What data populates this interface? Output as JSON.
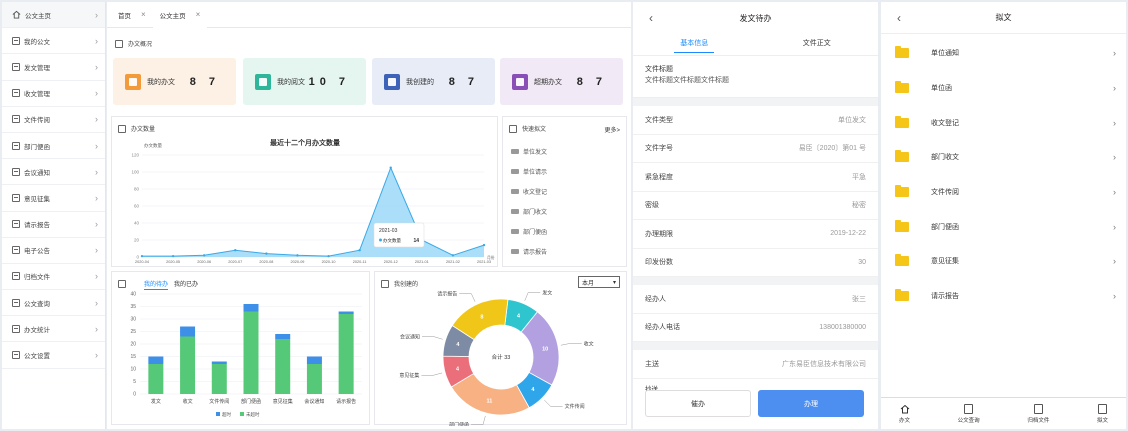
{
  "sidebar": {
    "items": [
      {
        "label": "公文主页",
        "icon": "home-icon"
      },
      {
        "label": "我的公文",
        "icon": "document-icon"
      },
      {
        "label": "发文管理",
        "icon": "document-icon"
      },
      {
        "label": "收文管理",
        "icon": "document-icon"
      },
      {
        "label": "文件传阅",
        "icon": "document-icon"
      },
      {
        "label": "部门便函",
        "icon": "document-icon"
      },
      {
        "label": "会议通知",
        "icon": "document-icon"
      },
      {
        "label": "意见征集",
        "icon": "document-icon"
      },
      {
        "label": "请示报告",
        "icon": "document-icon"
      },
      {
        "label": "电子公告",
        "icon": "document-icon"
      },
      {
        "label": "归档文件",
        "icon": "document-icon"
      },
      {
        "label": "公文查询",
        "icon": "document-icon"
      },
      {
        "label": "办文统计",
        "icon": "document-icon"
      },
      {
        "label": "公文设置",
        "icon": "document-icon"
      }
    ]
  },
  "tabs": [
    {
      "label": "首页"
    },
    {
      "label": "公文主页"
    }
  ],
  "overview": {
    "title": "办文概况",
    "cards": [
      {
        "label": "我的办文",
        "value": "8 7",
        "color": "#f39b3a",
        "bg": "#fdf1e6"
      },
      {
        "label": "我的阅文",
        "value": "10 7",
        "color": "#2fb59a",
        "bg": "#e5f6f1"
      },
      {
        "label": "我创建的",
        "value": "8 7",
        "color": "#3e62b8",
        "bg": "#e7ecf7"
      },
      {
        "label": "超期办文",
        "value": "8 7",
        "color": "#8a4fb6",
        "bg": "#f1e9f6"
      }
    ]
  },
  "count_panel": {
    "title": "办文数量",
    "chart_title": "最近十二个月办文数量",
    "ylabel": "办文数量",
    "x_unit": "月份",
    "tooltip_month": "2021-03",
    "tooltip_series": "办文数量",
    "tooltip_value": "14"
  },
  "quick_panel": {
    "title": "快速拟文",
    "more": "更多>",
    "items": [
      "单位发文",
      "单位请示",
      "收文登记",
      "部门收文",
      "部门便函",
      "请示报告"
    ]
  },
  "pending_panel": {
    "tab_active": "我的待办",
    "tab_other": "我的已办",
    "legend": [
      "超时",
      "未超时"
    ]
  },
  "created_panel": {
    "title": "我创建的",
    "select_value": "本月",
    "center_label": "合计 33"
  },
  "doc_pending": {
    "title": "发文待办",
    "tab_active": "基本信息",
    "tab_other": "文件正文",
    "heading_label": "文件标题",
    "heading_value": "文件标题文件标题文件标题",
    "rows1": [
      {
        "label": "文件类型",
        "value": "单位发文"
      },
      {
        "label": "文件字号",
        "value": "易臣〔2020〕第01 号"
      },
      {
        "label": "紧急程度",
        "value": "平急"
      },
      {
        "label": "密级",
        "value": "秘密"
      },
      {
        "label": "办理期限",
        "value": "2019-12-22"
      },
      {
        "label": "印发份数",
        "value": "30"
      }
    ],
    "rows2": [
      {
        "label": "经办人",
        "value": "张三"
      },
      {
        "label": "经办人电话",
        "value": "138001380000"
      }
    ],
    "rows3": [
      {
        "label": "主送",
        "value": "广东易臣信息技术有限公司"
      }
    ],
    "chaosong": "抄送",
    "btn_urge": "催办",
    "btn_handle": "办理"
  },
  "draft": {
    "title": "拟文",
    "items": [
      "单位通知",
      "单位函",
      "收文登记",
      "部门收文",
      "文件传阅",
      "部门便函",
      "意见征集",
      "请示报告"
    ],
    "nav": [
      {
        "label": "办文",
        "icon": "home-icon"
      },
      {
        "label": "公文查询",
        "icon": "search-doc-icon"
      },
      {
        "label": "归档文件",
        "icon": "archive-icon"
      },
      {
        "label": "拟文",
        "icon": "draft-icon"
      }
    ]
  },
  "chart_data": [
    {
      "type": "area",
      "title": "最近十二个月办文数量",
      "ylabel": "办文数量",
      "xlabel": "月份",
      "x": [
        "2020-04",
        "2020-05",
        "2020-06",
        "2020-07",
        "2020-08",
        "2020-09",
        "2020-10",
        "2020-11",
        "2020-12",
        "2021-01",
        "2021-02",
        "2021-03"
      ],
      "values": [
        1,
        1,
        2,
        8,
        4,
        2,
        1,
        8,
        105,
        20,
        2,
        14
      ],
      "ylim": [
        0,
        120
      ],
      "yticks": [
        0,
        20,
        40,
        60,
        80,
        100,
        120
      ],
      "grid": true
    },
    {
      "type": "bar",
      "stacked": true,
      "categories": [
        "发文",
        "收文",
        "文件传阅",
        "部门便函",
        "意见征集",
        "会议通知",
        "请示报告"
      ],
      "series": [
        {
          "name": "超时",
          "values": [
            3,
            4,
            1,
            3,
            2,
            3,
            1
          ],
          "color": "#3d8fe8"
        },
        {
          "name": "未超时",
          "values": [
            12,
            23,
            12,
            33,
            22,
            12,
            32
          ],
          "color": "#55c977"
        }
      ],
      "ylim": [
        0,
        40
      ],
      "yticks": [
        0,
        5,
        10,
        15,
        20,
        25,
        30,
        35,
        40
      ],
      "legend": "bottom"
    },
    {
      "type": "pie",
      "donut": true,
      "center_label": "合计 33",
      "slices": [
        {
          "label": "发文",
          "value": 4,
          "color": "#2ec5cf"
        },
        {
          "label": "收文",
          "value": 10,
          "color": "#b3a0e0"
        },
        {
          "label": "文件传阅",
          "value": 4,
          "color": "#2fa6ea"
        },
        {
          "label": "部门便函",
          "value": 11,
          "color": "#f7b183"
        },
        {
          "label": "意见征集",
          "value": 4,
          "color": "#ea6f7a"
        },
        {
          "label": "会议通知",
          "value": 4,
          "color": "#7e8ba4"
        },
        {
          "label": "请示报告",
          "value": 8,
          "color": "#f0c619"
        }
      ]
    }
  ]
}
